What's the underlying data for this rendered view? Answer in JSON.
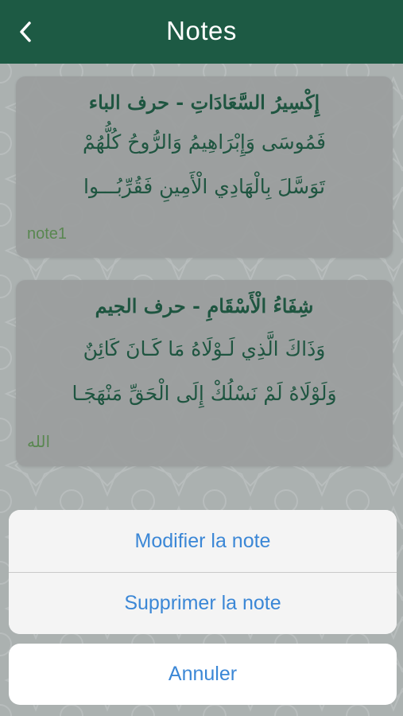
{
  "navbar": {
    "title": "Notes",
    "back_icon": "chevron-left-icon",
    "background_color": "#1d5a44"
  },
  "notes": [
    {
      "title": "إِكْسِيرُ السَّعَادَاتِ - حرف الباء",
      "line1": "فَمُوسَى وَإِبْرَاهِيمُ وَالرُّوحُ كُلُّهُمْ",
      "line2": "تَوَسَّلَ بِالْهَادِي الْأَمِينِ فَقُرِّبُـــوا",
      "label": "note1"
    },
    {
      "title": "شِفَاءُ الْأَسْقَامِ - حرف الجيم",
      "line1": "وَذَاكَ الَّذِي لَـوْلَاهُ مَا كَـانَ كَائِنٌ",
      "line2": "وَلَوْلَاهُ لَمْ نَسْلُكْ إِلَى الْحَقِّ مَنْهَجَـا",
      "label": "الله"
    }
  ],
  "action_sheet": {
    "modify_label": "Modifier la note",
    "delete_label": "Supprimer la note",
    "cancel_label": "Annuler",
    "accent_color": "#3b87d6"
  }
}
